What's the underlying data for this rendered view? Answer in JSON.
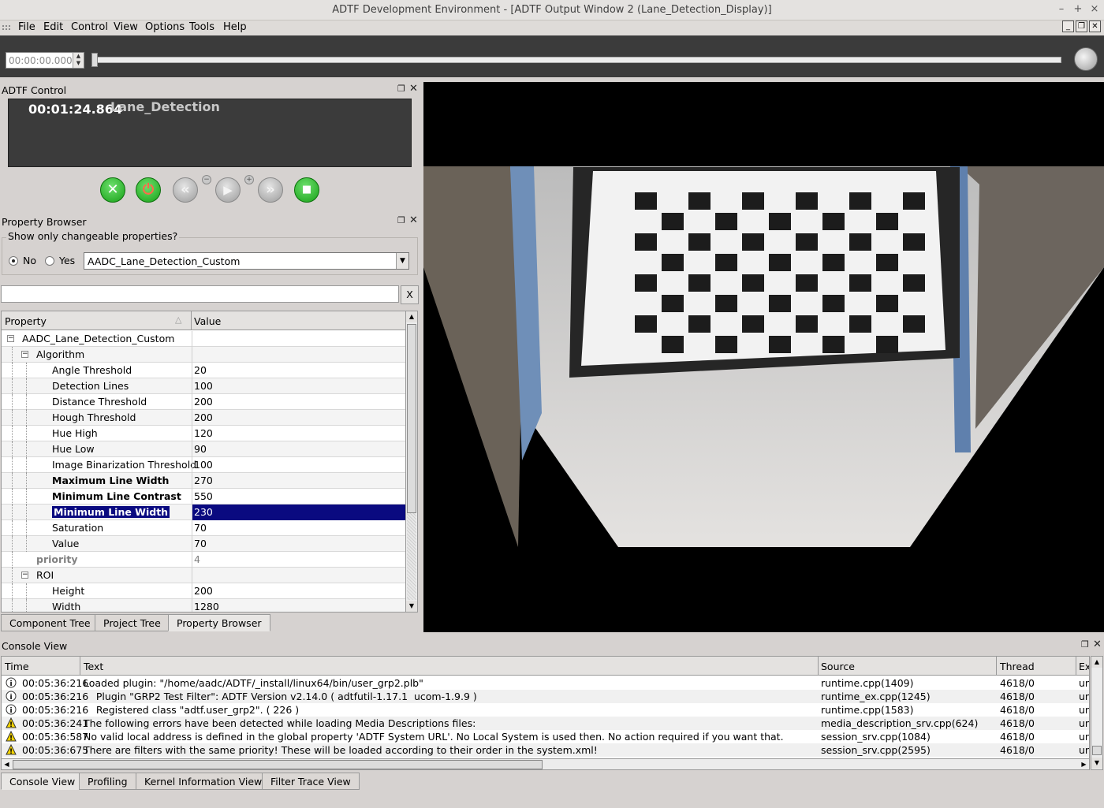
{
  "window": {
    "title": "ADTF Development Environment - [ADTF Output Window 2 (Lane_Detection_Display)]",
    "minimize": "–",
    "maximize": "+",
    "close": "×"
  },
  "menu": {
    "items": [
      "File",
      "Edit",
      "Control",
      "View",
      "Options",
      "Tools",
      "Help"
    ],
    "mdi_minimize": "_",
    "mdi_restore": "❐",
    "mdi_close": "✕"
  },
  "timeline": {
    "time_value": "00:00:00.000",
    "position": 0
  },
  "adtf_control": {
    "title": "ADTF Control",
    "time": "00:01:24.864",
    "configuration": "Lane_Detection"
  },
  "property_browser": {
    "title": "Property Browser",
    "show_changeable_label": "Show only changeable properties?",
    "no_label": "No",
    "yes_label": "Yes",
    "selected_option": "No",
    "combo_value": "AADC_Lane_Detection_Custom",
    "filter_value": "",
    "clear_label": "X",
    "col_property": "Property",
    "col_value": "Value",
    "rows": [
      {
        "name": "AADC_Lane_Detection_Custom",
        "value": ""
      },
      {
        "name": "Algorithm",
        "value": ""
      },
      {
        "name": "Angle Threshold",
        "value": "20"
      },
      {
        "name": "Detection Lines",
        "value": "100"
      },
      {
        "name": "Distance Threshold",
        "value": "200"
      },
      {
        "name": "Hough Threshold",
        "value": "200"
      },
      {
        "name": "Hue High",
        "value": "120"
      },
      {
        "name": "Hue Low",
        "value": "90"
      },
      {
        "name": "Image Binarization Threshold",
        "value": "100"
      },
      {
        "name": "Maximum Line Width",
        "value": "270"
      },
      {
        "name": "Minimum Line Contrast",
        "value": "550"
      },
      {
        "name": "Minimum Line Width",
        "value": "230"
      },
      {
        "name": "Saturation",
        "value": "70"
      },
      {
        "name": "Value",
        "value": "70"
      },
      {
        "name": "priority",
        "value": "4"
      },
      {
        "name": "ROI",
        "value": ""
      },
      {
        "name": "Height",
        "value": "200"
      },
      {
        "name": "Width",
        "value": "1280"
      }
    ]
  },
  "left_tabs": [
    "Component Tree",
    "Project Tree",
    "Property Browser"
  ],
  "console": {
    "title": "Console View",
    "columns": [
      "Time",
      "Text",
      "Source",
      "Thread",
      "Ex"
    ],
    "rows": [
      {
        "type": "info",
        "time": "00:05:36:216",
        "text": "Loaded plugin: \"/home/aadc/ADTF/_install/linux64/bin/user_grp2.plb\"",
        "source": "runtime.cpp(1409)",
        "thread": "4618/0",
        "ex": "un"
      },
      {
        "type": "info",
        "time": "00:05:36:216",
        "text": "    Plugin \"GRP2 Test Filter\": ADTF Version v2.14.0 ( adtfutil-1.17.1  ucom-1.9.9 )",
        "source": "runtime_ex.cpp(1245)",
        "thread": "4618/0",
        "ex": "un"
      },
      {
        "type": "info",
        "time": "00:05:36:216",
        "text": "    Registered class \"adtf.user_grp2\". ( 226 )",
        "source": "runtime.cpp(1583)",
        "thread": "4618/0",
        "ex": "un"
      },
      {
        "type": "warning",
        "time": "00:05:36:241",
        "text": "The following errors have been detected while loading Media Descriptions files:",
        "source": "media_description_srv.cpp(624)",
        "thread": "4618/0",
        "ex": "un"
      },
      {
        "type": "warning",
        "time": "00:05:36:587",
        "text": "No valid local address is defined in the global property 'ADTF System URL'. No Local System is used then. No action required if you want that.",
        "source": "session_srv.cpp(1084)",
        "thread": "4618/0",
        "ex": "un"
      },
      {
        "type": "warning",
        "time": "00:05:36:675",
        "text": "There are filters with the same priority! These will be loaded according to their order in the system.xml!",
        "source": "session_srv.cpp(2595)",
        "thread": "4618/0",
        "ex": "un"
      }
    ]
  },
  "bottom_tabs": [
    "Console View",
    "Profiling",
    "Kernel Information View",
    "Filter Trace View"
  ],
  "colors": {
    "selection": "#0a0a80",
    "play_green": "#16a016",
    "toolbar_dark": "#3b3b3b"
  }
}
